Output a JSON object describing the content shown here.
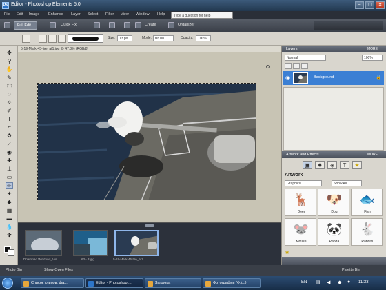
{
  "window": {
    "title": "Editor - Photoshop Elements 5.0",
    "icon_label": "Ps",
    "controls": {
      "minimize": "−",
      "maximize": "□",
      "close": "✕"
    }
  },
  "menubar": {
    "items": [
      "File",
      "Edit",
      "Image",
      "Enhance",
      "Layer",
      "Select",
      "Filter",
      "View",
      "Window",
      "Help"
    ],
    "help_search_placeholder": "Type a question for help"
  },
  "modebar": {
    "full_edit": "Full Edit",
    "quick_fix": "Quick Fix",
    "undo_icon": "undo-icon",
    "redo_icon": "redo-icon",
    "create": "Create",
    "organizer": "Organizer"
  },
  "options": {
    "size_label": "Size:",
    "size_value": "13 px",
    "mode_label": "Mode:",
    "mode_value": "Brush",
    "opacity_label": "Opacity:",
    "opacity_value": "100%"
  },
  "document": {
    "tab_title": "5-19-Mark-45-fire_at1.jpg @ 47.8% (RGB/8)"
  },
  "photobin": {
    "thumbs": [
      {
        "caption": "Download Windows_Vis..."
      },
      {
        "caption": "63 - 3.jpg"
      },
      {
        "caption": "5-19-Mark-45-fire_at1..."
      }
    ],
    "bin_label": "Photo Bin",
    "bin_menu": "Show Open Files"
  },
  "layers": {
    "title": "Layers",
    "more": "MORE",
    "mode": "Normal",
    "opacity": "100%",
    "layer_name": "Background"
  },
  "artwork": {
    "panel_title": "Artwork and Effects",
    "more": "MORE",
    "section_title": "Artwork",
    "category": "Graphics",
    "filter": "Show All",
    "items": [
      {
        "label": "Deer",
        "glyph": "🦌"
      },
      {
        "label": "Dog",
        "glyph": "🐶"
      },
      {
        "label": "Fish",
        "glyph": "🐟"
      },
      {
        "label": "Mouse",
        "glyph": "🐭"
      },
      {
        "label": "Panda",
        "glyph": "🐼"
      },
      {
        "label": "Rabbit1",
        "glyph": "🐇"
      }
    ]
  },
  "statusbar": {
    "left": "Photo Bin",
    "middle": "Show Open Files",
    "right": "Palette Bin"
  },
  "taskbar": {
    "tasks": [
      "Список клипов: фа...",
      "Editor - Photoshop ...",
      "Загрузка",
      "Фотографии (Ф:\\...)"
    ],
    "language": "EN",
    "clock": "11:33"
  },
  "colors": {
    "accent_blue": "#3b7fd4",
    "toolbar_gray": "#d9d6ce",
    "dark_chrome": "#2a2f38"
  }
}
